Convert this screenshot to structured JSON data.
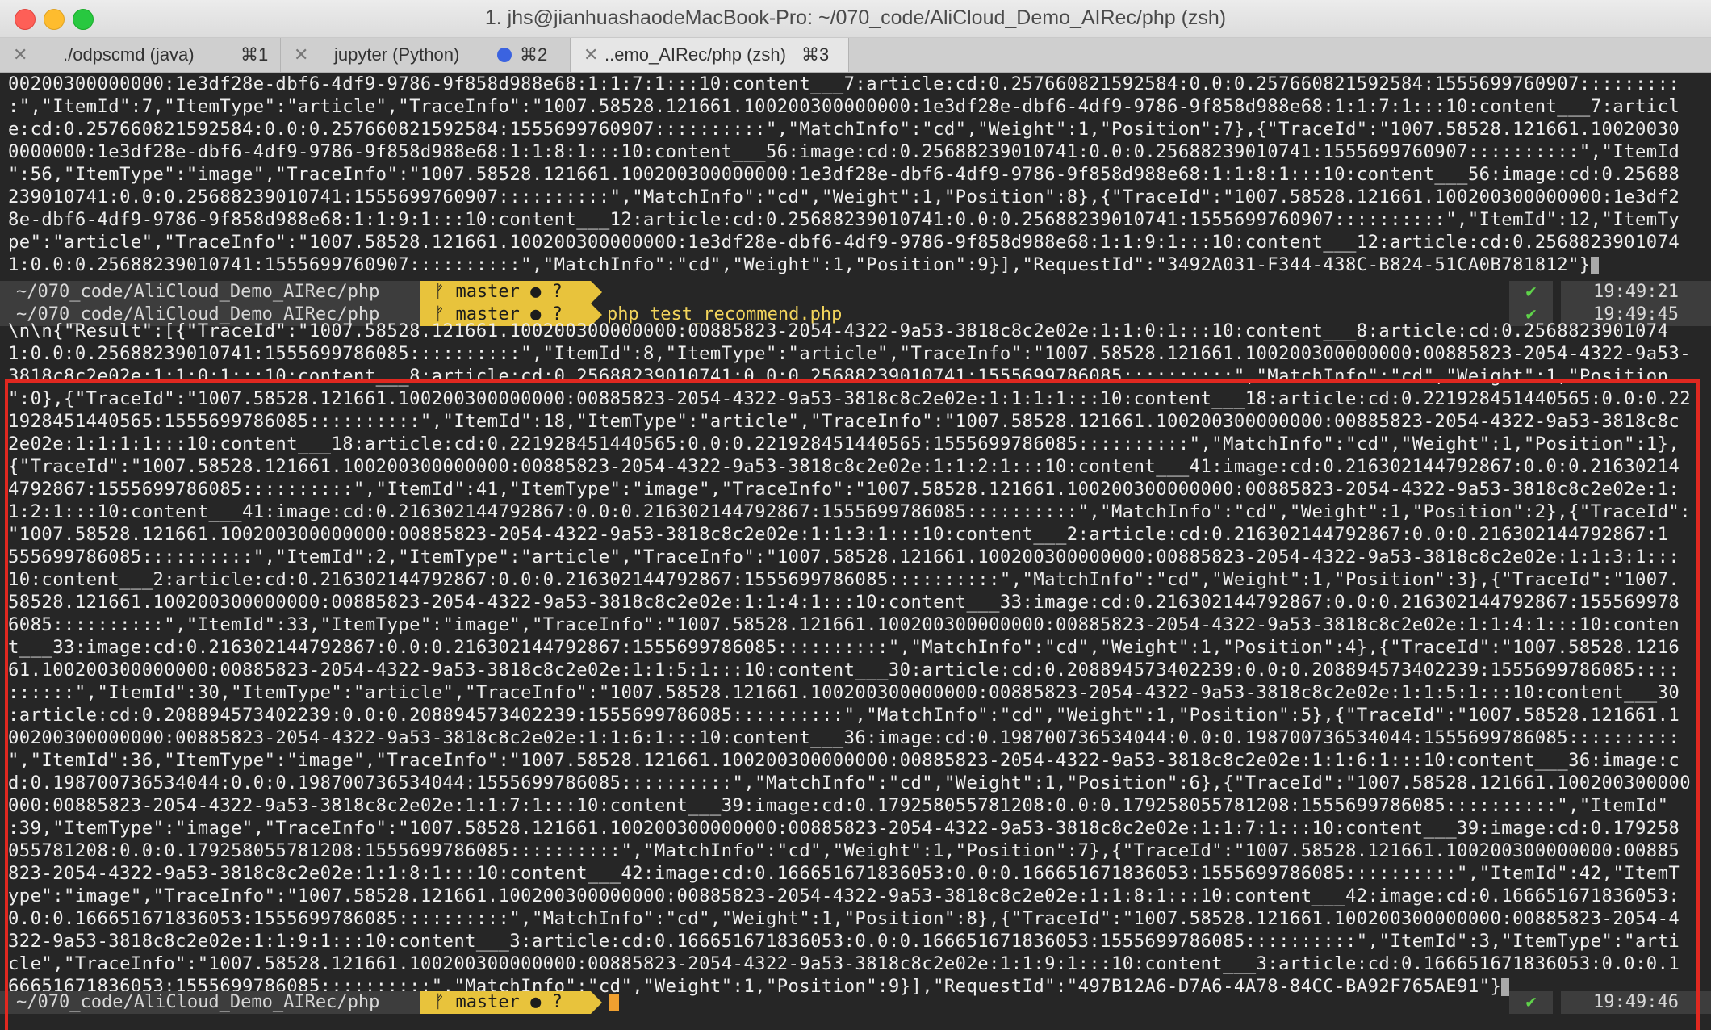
{
  "window": {
    "title": "1. jhs@jianhuashaodeMacBook-Pro: ~/070_code/AliCloud_Demo_AIRec/php (zsh)"
  },
  "tabs": [
    {
      "name": "./odpscmd (java)",
      "shortcut": "⌘1",
      "close": "✕"
    },
    {
      "name": "jupyter (Python)",
      "shortcut": "⌘2",
      "close": "✕"
    },
    {
      "name": "..emo_AIRec/php (zsh)",
      "shortcut": "⌘3",
      "close": "✕"
    }
  ],
  "output_top": [
    "00200300000000:1e3df28e-dbf6-4df9-9786-9f858d988e68:1:1:7:1:::10:content___7:article:cd:0.257660821592584:0.0:0.257660821592584:1555699760907:::::::::",
    ":\",\"ItemId\":7,\"ItemType\":\"article\",\"TraceInfo\":\"1007.58528.121661.100200300000000:1e3df28e-dbf6-4df9-9786-9f858d988e68:1:1:7:1:::10:content___7:articl",
    "e:cd:0.257660821592584:0.0:0.257660821592584:1555699760907::::::::::\",\"MatchInfo\":\"cd\",\"Weight\":1,\"Position\":7},{\"TraceId\":\"1007.58528.121661.10020030",
    "0000000:1e3df28e-dbf6-4df9-9786-9f858d988e68:1:1:8:1:::10:content___56:image:cd:0.25688239010741:0.0:0.25688239010741:1555699760907::::::::::\",\"ItemId",
    "\":56,\"ItemType\":\"image\",\"TraceInfo\":\"1007.58528.121661.100200300000000:1e3df28e-dbf6-4df9-9786-9f858d988e68:1:1:8:1:::10:content___56:image:cd:0.25688",
    "239010741:0.0:0.25688239010741:1555699760907::::::::::\",\"MatchInfo\":\"cd\",\"Weight\":1,\"Position\":8},{\"TraceId\":\"1007.58528.121661.100200300000000:1e3df2",
    "8e-dbf6-4df9-9786-9f858d988e68:1:1:9:1:::10:content___12:article:cd:0.25688239010741:0.0:0.25688239010741:1555699760907::::::::::\",\"ItemId\":12,\"ItemTy",
    "pe\":\"article\",\"TraceInfo\":\"1007.58528.121661.100200300000000:1e3df28e-dbf6-4df9-9786-9f858d988e68:1:1:9:1:::10:content___12:article:cd:0.2568823901074",
    "1:0.0:0.25688239010741:1555699760907::::::::::\",\"MatchInfo\":\"cd\",\"Weight\":1,\"Position\":9}],\"RequestId\":\"3492A031-F344-438C-B824-51CA0B781812\"}"
  ],
  "prompt1": {
    "dir": "~/070_code/AliCloud_Demo_AIRec/php",
    "git": "ᚠ master ● ?",
    "check": "✔",
    "time": "19:49:21"
  },
  "prompt2": {
    "dir": "~/070_code/AliCloud_Demo_AIRec/php",
    "git": "ᚠ master ● ?",
    "command": "php test_recommend.php",
    "check": "✔",
    "time": "19:49:45"
  },
  "output_main": [
    "\\n\\n{\"Result\":[{\"TraceId\":\"1007.58528.121661.100200300000000:00885823-2054-4322-9a53-3818c8c2e02e:1:1:0:1:::10:content___8:article:cd:0.2568823901074",
    "1:0.0:0.25688239010741:1555699786085::::::::::\",\"ItemId\":8,\"ItemType\":\"article\",\"TraceInfo\":\"1007.58528.121661.100200300000000:00885823-2054-4322-9a53-",
    "3818c8c2e02e:1:1:0:1:::10:content___8:article:cd:0.25688239010741:0.0:0.25688239010741:1555699786085::::::::::\",\"MatchInfo\":\"cd\",\"Weight\":1,\"Position",
    "\":0},{\"TraceId\":\"1007.58528.121661.100200300000000:00885823-2054-4322-9a53-3818c8c2e02e:1:1:1:1:::10:content___18:article:cd:0.221928451440565:0.0:0.22",
    "1928451440565:1555699786085::::::::::\",\"ItemId\":18,\"ItemType\":\"article\",\"TraceInfo\":\"1007.58528.121661.100200300000000:00885823-2054-4322-9a53-3818c8c",
    "2e02e:1:1:1:1:::10:content___18:article:cd:0.221928451440565:0.0:0.221928451440565:1555699786085::::::::::\",\"MatchInfo\":\"cd\",\"Weight\":1,\"Position\":1},",
    "{\"TraceId\":\"1007.58528.121661.100200300000000:00885823-2054-4322-9a53-3818c8c2e02e:1:1:2:1:::10:content___41:image:cd:0.216302144792867:0.0:0.21630214",
    "4792867:1555699786085::::::::::\",\"ItemId\":41,\"ItemType\":\"image\",\"TraceInfo\":\"1007.58528.121661.100200300000000:00885823-2054-4322-9a53-3818c8c2e02e:1:",
    "1:2:1:::10:content___41:image:cd:0.216302144792867:0.0:0.216302144792867:1555699786085::::::::::\",\"MatchInfo\":\"cd\",\"Weight\":1,\"Position\":2},{\"TraceId\":",
    "\"1007.58528.121661.100200300000000:00885823-2054-4322-9a53-3818c8c2e02e:1:1:3:1:::10:content___2:article:cd:0.216302144792867:0.0:0.216302144792867:1",
    "555699786085::::::::::\",\"ItemId\":2,\"ItemType\":\"article\",\"TraceInfo\":\"1007.58528.121661.100200300000000:00885823-2054-4322-9a53-3818c8c2e02e:1:1:3:1:::",
    "10:content___2:article:cd:0.216302144792867:0.0:0.216302144792867:1555699786085::::::::::\",\"MatchInfo\":\"cd\",\"Weight\":1,\"Position\":3},{\"TraceId\":\"1007.",
    "58528.121661.100200300000000:00885823-2054-4322-9a53-3818c8c2e02e:1:1:4:1:::10:content___33:image:cd:0.216302144792867:0.0:0.216302144792867:155569978",
    "6085::::::::::\",\"ItemId\":33,\"ItemType\":\"image\",\"TraceInfo\":\"1007.58528.121661.100200300000000:00885823-2054-4322-9a53-3818c8c2e02e:1:1:4:1:::10:conten",
    "t___33:image:cd:0.216302144792867:0.0:0.216302144792867:1555699786085::::::::::\",\"MatchInfo\":\"cd\",\"Weight\":1,\"Position\":4},{\"TraceId\":\"1007.58528.1216",
    "61.100200300000000:00885823-2054-4322-9a53-3818c8c2e02e:1:1:5:1:::10:content___30:article:cd:0.208894573402239:0.0:0.208894573402239:1555699786085::::",
    "::::::\",\"ItemId\":30,\"ItemType\":\"article\",\"TraceInfo\":\"1007.58528.121661.100200300000000:00885823-2054-4322-9a53-3818c8c2e02e:1:1:5:1:::10:content___30",
    ":article:cd:0.208894573402239:0.0:0.208894573402239:1555699786085::::::::::\",\"MatchInfo\":\"cd\",\"Weight\":1,\"Position\":5},{\"TraceId\":\"1007.58528.121661.1",
    "00200300000000:00885823-2054-4322-9a53-3818c8c2e02e:1:1:6:1:::10:content___36:image:cd:0.198700736534044:0.0:0.198700736534044:1555699786085::::::::::",
    "\",\"ItemId\":36,\"ItemType\":\"image\",\"TraceInfo\":\"1007.58528.121661.100200300000000:00885823-2054-4322-9a53-3818c8c2e02e:1:1:6:1:::10:content___36:image:c",
    "d:0.198700736534044:0.0:0.198700736534044:1555699786085::::::::::\",\"MatchInfo\":\"cd\",\"Weight\":1,\"Position\":6},{\"TraceId\":\"1007.58528.121661.100200300000",
    "000:00885823-2054-4322-9a53-3818c8c2e02e:1:1:7:1:::10:content___39:image:cd:0.179258055781208:0.0:0.179258055781208:1555699786085::::::::::\",\"ItemId\"",
    ":39,\"ItemType\":\"image\",\"TraceInfo\":\"1007.58528.121661.100200300000000:00885823-2054-4322-9a53-3818c8c2e02e:1:1:7:1:::10:content___39:image:cd:0.179258",
    "055781208:0.0:0.179258055781208:1555699786085::::::::::\",\"MatchInfo\":\"cd\",\"Weight\":1,\"Position\":7},{\"TraceId\":\"1007.58528.121661.100200300000000:00885",
    "823-2054-4322-9a53-3818c8c2e02e:1:1:8:1:::10:content___42:image:cd:0.166651671836053:0.0:0.166651671836053:1555699786085::::::::::\",\"ItemId\":42,\"ItemT",
    "ype\":\"image\",\"TraceInfo\":\"1007.58528.121661.100200300000000:00885823-2054-4322-9a53-3818c8c2e02e:1:1:8:1:::10:content___42:image:cd:0.166651671836053:",
    "0.0:0.166651671836053:1555699786085::::::::::\",\"MatchInfo\":\"cd\",\"Weight\":1,\"Position\":8},{\"TraceId\":\"1007.58528.121661.100200300000000:00885823-2054-4",
    "322-9a53-3818c8c2e02e:1:1:9:1:::10:content___3:article:cd:0.166651671836053:0.0:0.166651671836053:1555699786085::::::::::\",\"ItemId\":3,\"ItemType\":\"arti",
    "cle\",\"TraceInfo\":\"1007.58528.121661.100200300000000:00885823-2054-4322-9a53-3818c8c2e02e:1:1:9:1:::10:content___3:article:cd:0.166651671836053:0.0:0.1",
    "66651671836053:1555699786085::::::::::\",\"MatchInfo\":\"cd\",\"Weight\":1,\"Position\":9}],\"RequestId\":\"497B12A6-D7A6-4A78-84CC-BA92F765AE91\"}"
  ],
  "prompt3": {
    "dir": "~/070_code/AliCloud_Demo_AIRec/php",
    "git": "ᚠ master ● ?",
    "check": "✔",
    "time": "19:49:46"
  },
  "colors": {
    "highlight_box": "#e02820",
    "git_segment": "#e8c33c",
    "command_text": "#f2d45c",
    "check_mark": "#5fd34a"
  }
}
